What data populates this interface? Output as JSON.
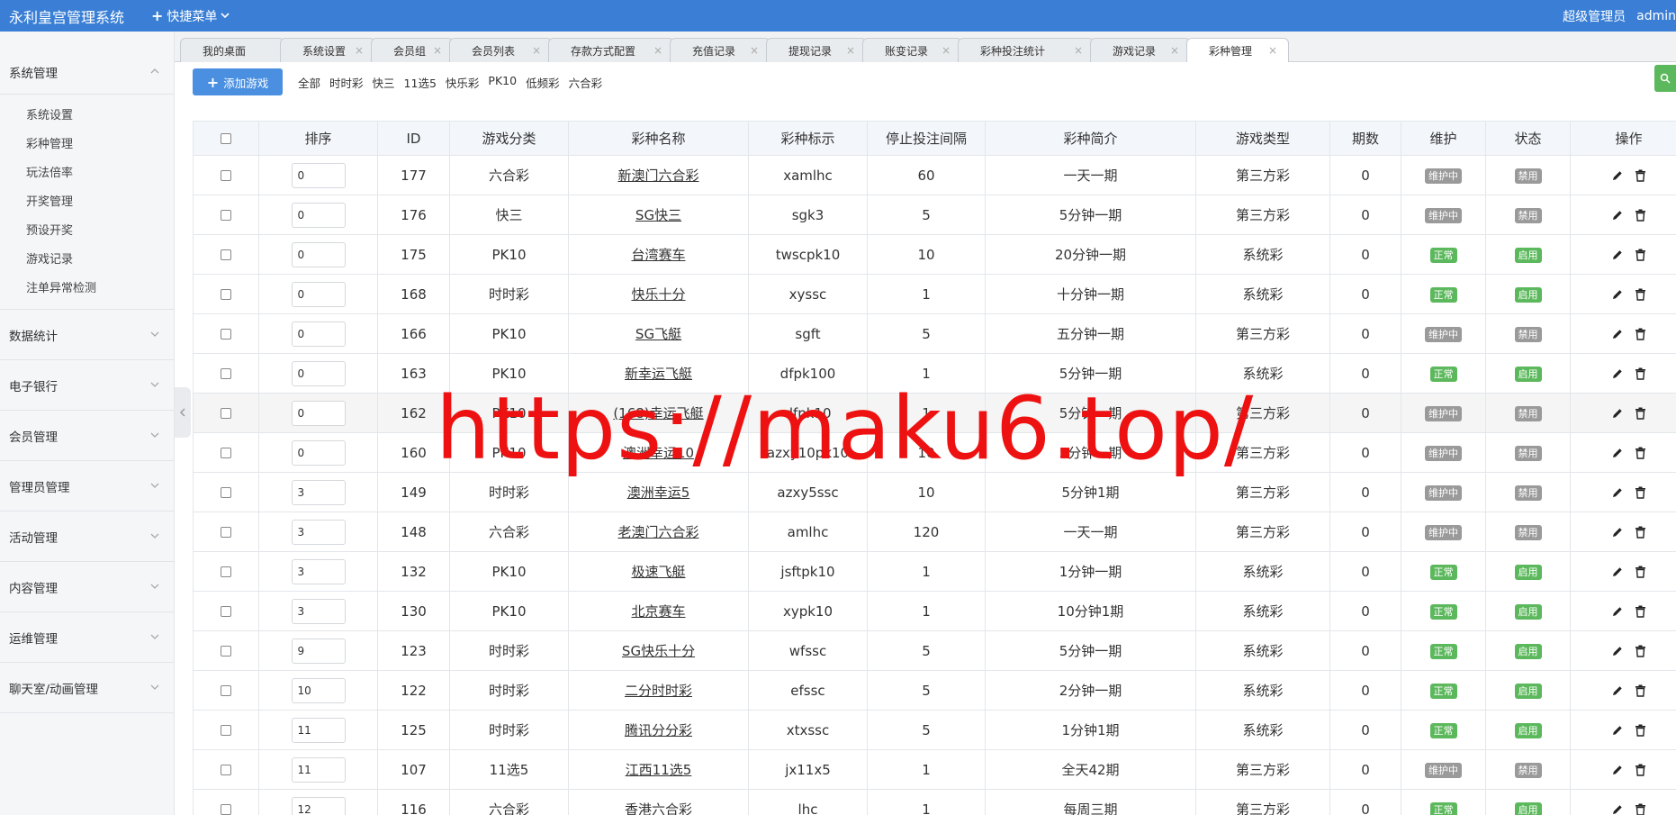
{
  "header": {
    "brand": "永利皇宫管理系统",
    "quick_menu": "快捷菜单",
    "role": "超级管理员",
    "user": "admin"
  },
  "sidebar": {
    "groups": [
      {
        "label": "系统管理",
        "expanded": true,
        "items": [
          "系统设置",
          "彩种管理",
          "玩法倍率",
          "开奖管理",
          "预设开奖",
          "游戏记录",
          "注单异常检测"
        ]
      },
      {
        "label": "数据统计"
      },
      {
        "label": "电子银行"
      },
      {
        "label": "会员管理"
      },
      {
        "label": "管理员管理"
      },
      {
        "label": "活动管理"
      },
      {
        "label": "内容管理"
      },
      {
        "label": "运维管理"
      },
      {
        "label": "聊天室/动画管理"
      }
    ]
  },
  "tabs": [
    "我的桌面",
    "系统设置",
    "会员组",
    "会员列表",
    "存款方式配置",
    "充值记录",
    "提现记录",
    "账变记录",
    "彩种投注统计",
    "游戏记录",
    "彩种管理"
  ],
  "toolbar": {
    "add_label": "添加游戏",
    "filters": [
      "全部",
      "时时彩",
      "快三",
      "11选5",
      "快乐彩",
      "PK10",
      "低频彩",
      "六合彩"
    ]
  },
  "table": {
    "headers": [
      "",
      "排序",
      "ID",
      "游戏分类",
      "彩种名称",
      "彩种标示",
      "停止投注间隔",
      "彩种简介",
      "游戏类型",
      "期数",
      "维护",
      "状态",
      "操作"
    ],
    "rows": [
      {
        "sort": "0",
        "id": "177",
        "category": "六合彩",
        "name": "新澳门六合彩",
        "code": "xamlhc",
        "stop": "60",
        "intro": "一天一期",
        "type": "第三方彩",
        "periods": "0",
        "maint": "维护中",
        "status": "禁用"
      },
      {
        "sort": "0",
        "id": "176",
        "category": "快三",
        "name": "SG快三",
        "code": "sgk3",
        "stop": "5",
        "intro": "5分钟一期",
        "type": "第三方彩",
        "periods": "0",
        "maint": "维护中",
        "status": "禁用"
      },
      {
        "sort": "0",
        "id": "175",
        "category": "PK10",
        "name": "台湾赛车",
        "code": "twscpk10",
        "stop": "10",
        "intro": "20分钟一期",
        "type": "系统彩",
        "periods": "0",
        "maint": "正常",
        "status": "启用"
      },
      {
        "sort": "0",
        "id": "168",
        "category": "时时彩",
        "name": "快乐十分",
        "code": "xyssc",
        "stop": "1",
        "intro": "十分钟一期",
        "type": "系统彩",
        "periods": "0",
        "maint": "正常",
        "status": "启用"
      },
      {
        "sort": "0",
        "id": "166",
        "category": "PK10",
        "name": "SG飞艇",
        "code": "sgft",
        "stop": "5",
        "intro": "五分钟一期",
        "type": "第三方彩",
        "periods": "0",
        "maint": "维护中",
        "status": "禁用"
      },
      {
        "sort": "0",
        "id": "163",
        "category": "PK10",
        "name": "新幸运飞艇",
        "code": "dfpk100",
        "stop": "1",
        "intro": "5分钟一期",
        "type": "系统彩",
        "periods": "0",
        "maint": "正常",
        "status": "启用"
      },
      {
        "sort": "0",
        "id": "162",
        "category": "PK10",
        "name": "(168)幸运飞艇",
        "code": "dfpk10",
        "stop": "1",
        "intro": "5分钟一期",
        "type": "第三方彩",
        "periods": "0",
        "maint": "维护中",
        "status": "禁用"
      },
      {
        "sort": "0",
        "id": "160",
        "category": "PK10",
        "name": "澳洲幸运10",
        "code": "azxy10pk10",
        "stop": "10",
        "intro": "5分钟一期",
        "type": "第三方彩",
        "periods": "0",
        "maint": "维护中",
        "status": "禁用"
      },
      {
        "sort": "3",
        "id": "149",
        "category": "时时彩",
        "name": "澳洲幸运5",
        "code": "azxy5ssc",
        "stop": "10",
        "intro": "5分钟1期",
        "type": "第三方彩",
        "periods": "0",
        "maint": "维护中",
        "status": "禁用"
      },
      {
        "sort": "3",
        "id": "148",
        "category": "六合彩",
        "name": "老澳门六合彩",
        "code": "amlhc",
        "stop": "120",
        "intro": "一天一期",
        "type": "第三方彩",
        "periods": "0",
        "maint": "维护中",
        "status": "禁用"
      },
      {
        "sort": "3",
        "id": "132",
        "category": "PK10",
        "name": "极速飞艇",
        "code": "jsftpk10",
        "stop": "1",
        "intro": "1分钟一期",
        "type": "系统彩",
        "periods": "0",
        "maint": "正常",
        "status": "启用"
      },
      {
        "sort": "3",
        "id": "130",
        "category": "PK10",
        "name": "北京赛车",
        "code": "xypk10",
        "stop": "1",
        "intro": "10分钟1期",
        "type": "系统彩",
        "periods": "0",
        "maint": "正常",
        "status": "启用"
      },
      {
        "sort": "9",
        "id": "123",
        "category": "时时彩",
        "name": "SG快乐十分",
        "code": "wfssc",
        "stop": "5",
        "intro": "5分钟一期",
        "type": "系统彩",
        "periods": "0",
        "maint": "正常",
        "status": "启用"
      },
      {
        "sort": "10",
        "id": "122",
        "category": "时时彩",
        "name": "二分时时彩",
        "code": "efssc",
        "stop": "5",
        "intro": "2分钟一期",
        "type": "系统彩",
        "periods": "0",
        "maint": "正常",
        "status": "启用"
      },
      {
        "sort": "11",
        "id": "125",
        "category": "时时彩",
        "name": "腾讯分分彩",
        "code": "xtxssc",
        "stop": "5",
        "intro": "1分钟1期",
        "type": "系统彩",
        "periods": "0",
        "maint": "正常",
        "status": "启用"
      },
      {
        "sort": "11",
        "id": "107",
        "category": "11选5",
        "name": "江西11选5",
        "code": "jx11x5",
        "stop": "1",
        "intro": "全天42期",
        "type": "第三方彩",
        "periods": "0",
        "maint": "维护中",
        "status": "禁用"
      },
      {
        "sort": "12",
        "id": "116",
        "category": "六合彩",
        "name": "香港六合彩",
        "code": "lhc",
        "stop": "1",
        "intro": "每周三期",
        "type": "第三方彩",
        "periods": "0",
        "maint": "正常",
        "status": "启用"
      }
    ]
  },
  "watermark": "https://maku6.top/",
  "colors": {
    "header_bg": "#3a7fd5",
    "badge_gray": "#9a9a9a",
    "badge_green": "#5cb85c",
    "watermark": "#ee1111"
  }
}
